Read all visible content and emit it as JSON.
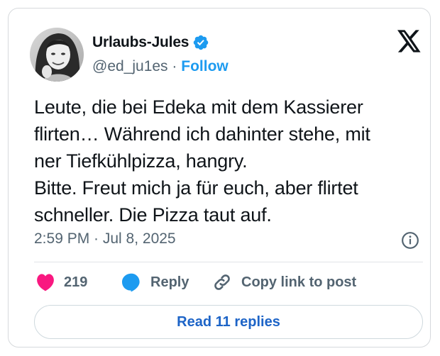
{
  "author": {
    "display_name": "Urlaubs-Jules",
    "handle": "@ed_ju1es",
    "separator": "·",
    "follow_label": "Follow",
    "verified_icon": "verified-badge-icon",
    "avatar_icon": "profile-photo"
  },
  "platform_icon": "x-logo-icon",
  "tweet": {
    "lines": [
      "Leute, die bei Edeka mit dem Kassierer",
      "flirten… Während ich dahinter stehe, mit",
      "ner Tiefkühlpizza, hangry.",
      "Bitte. Freut mich ja für euch, aber flirtet",
      "schneller. Die Pizza taut auf."
    ],
    "timestamp": "2:59 PM · Jul 8, 2025",
    "info_icon": "info-icon"
  },
  "actions": {
    "like_count": "219",
    "reply_label": "Reply",
    "copy_label": "Copy link to post",
    "read_replies_label": "Read 11 replies"
  },
  "colors": {
    "accent": "#1d9bf0",
    "like": "#f91880",
    "text": "#0f1419",
    "muted": "#536471",
    "read_button_text": "#1d64c7"
  }
}
